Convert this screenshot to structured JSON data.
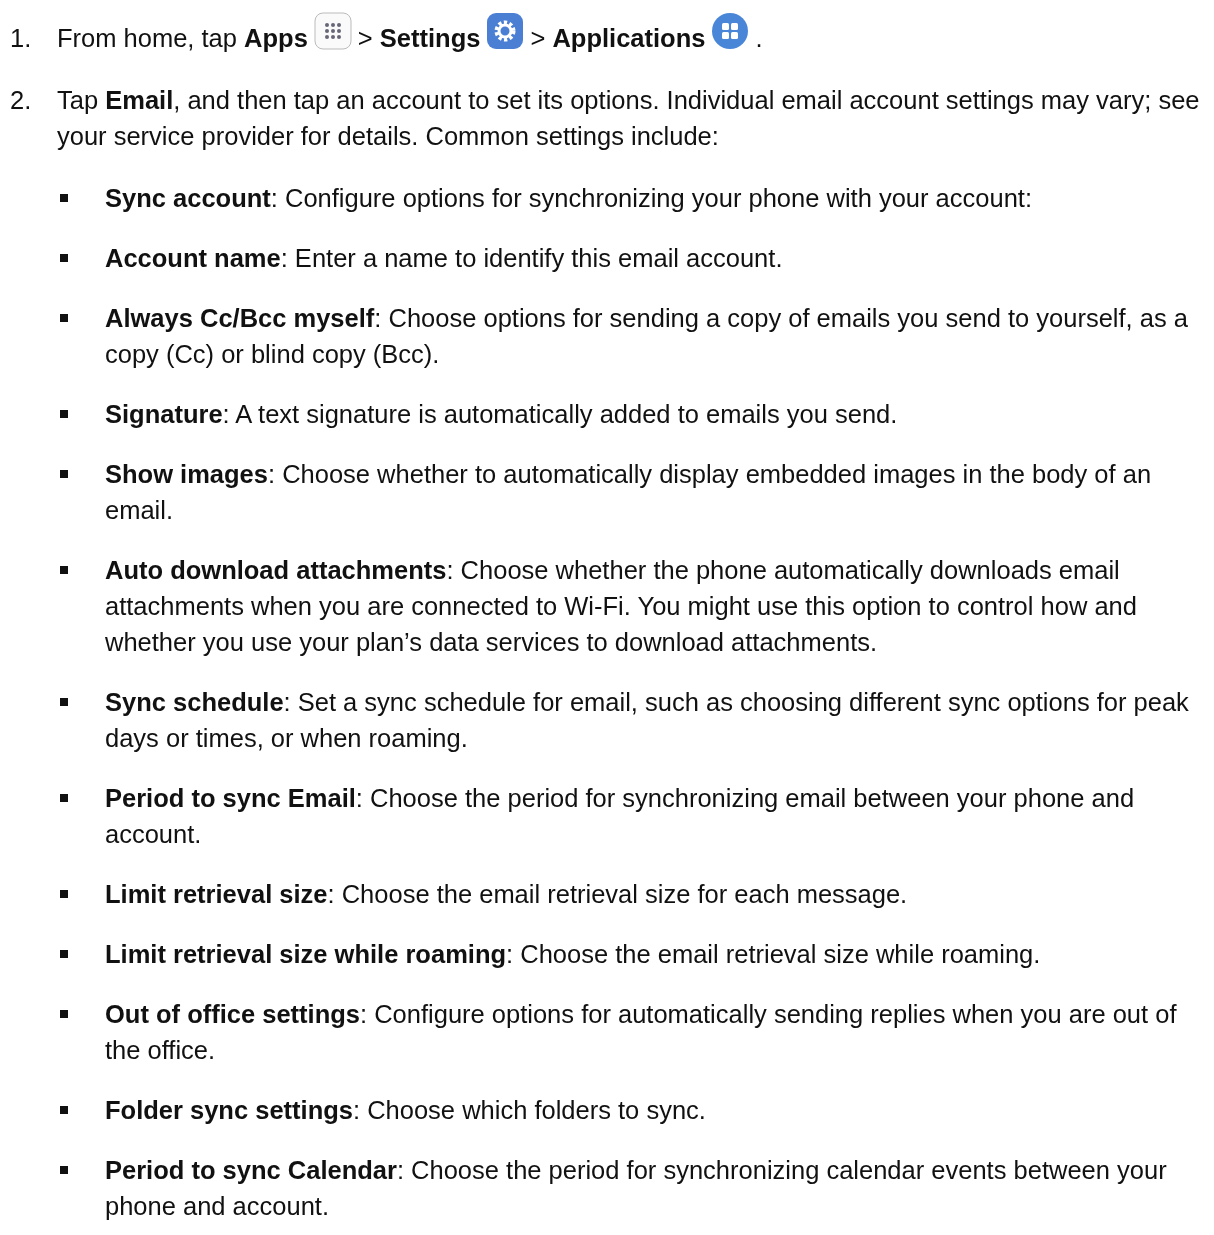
{
  "steps": [
    {
      "number": "1.",
      "parts": [
        {
          "kind": "text",
          "text": "From home, tap **Apps**"
        },
        {
          "kind": "grid"
        },
        {
          "kind": "text",
          "text": "> **Settings**"
        },
        {
          "kind": "gear"
        },
        {
          "kind": "text",
          "text": "> **Applications**"
        },
        {
          "kind": "tiles"
        },
        {
          "kind": "text",
          "text": "."
        }
      ]
    },
    {
      "number": "2.",
      "parts": [
        {
          "kind": "text",
          "text": "Tap **Email**, and then tap an account to set its options. Individual email account settings may vary; see your service provider for details. Common settings include:"
        }
      ],
      "bullets": [
        "**Sync account**: Configure options for synchronizing your phone with your account:",
        "**Account name**: Enter a name to identify this email account.",
        "**Always Cc/Bcc myself**: Choose options for sending a copy of emails you send to yourself, as a copy (Cc) or blind copy (Bcc).",
        "**Signature**: A text signature is automatically added to emails you send.",
        "**Show images**: Choose whether to automatically display embedded images in the body of an email.",
        "**Auto download attachments**: Choose whether the phone automatically downloads email attachments when you are connected to Wi-Fi. You might use this option to control how and whether you use your plan’s data services to download attachments.",
        "**Sync schedule**: Set a sync schedule for email, such as choosing different sync options for peak days or times, or when roaming.",
        "**Period to sync Email**: Choose the period for synchronizing email between your phone and account.",
        "**Limit retrieval size**: Choose the email retrieval size for each message.",
        "**Limit retrieval size while roaming**: Choose the email retrieval size while roaming.",
        "**Out of office settings**: Configure options for automatically sending replies when you are out of the office.",
        "**Folder sync settings**: Choose which folders to sync.",
        "**Period to sync Calendar**: Choose the period for synchronizing calendar events between your phone and account."
      ]
    }
  ]
}
